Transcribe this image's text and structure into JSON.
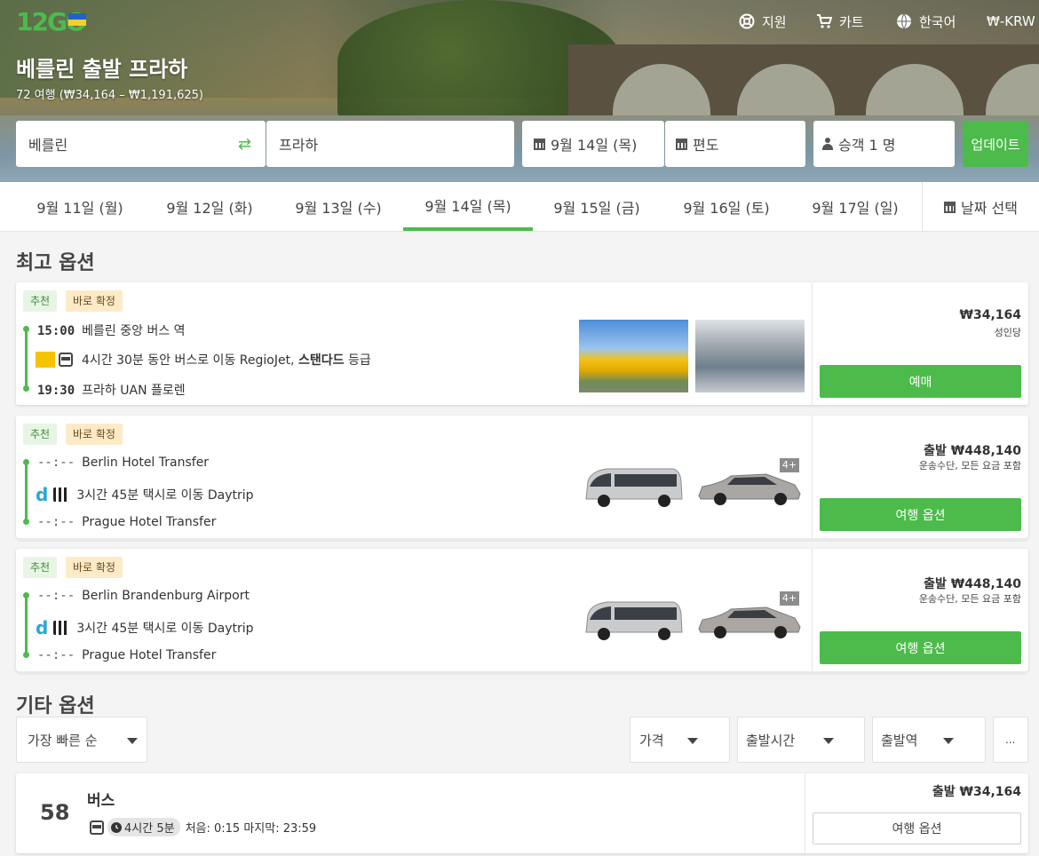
{
  "header": {
    "logo_text": "12GO",
    "nav": [
      {
        "label": "지원",
        "icon": "lifebuoy-icon"
      },
      {
        "label": "카트",
        "icon": "cart-icon"
      },
      {
        "label": "한국어",
        "icon": "globe-icon"
      },
      {
        "label": "₩-KRW",
        "icon": ""
      }
    ]
  },
  "route": {
    "title": "베를린 출발 프라하",
    "summary": "72 여행 (₩34,164 – ₩1,191,625)"
  },
  "search": {
    "from": "베를린",
    "to": "프라하",
    "date": "9월 14일 (목)",
    "return": "편도",
    "passengers": "승객 1 명",
    "update_label": "업데이트"
  },
  "date_tabs": [
    "9월 11일 (월)",
    "9월 12일 (화)",
    "9월 13일 (수)",
    "9월 14일 (목)",
    "9월 15일 (금)",
    "9월 16일 (토)",
    "9월 17일 (일)"
  ],
  "active_date_index": 3,
  "date_picker_label": "날짜 선택",
  "best_options_title": "최고 옵션",
  "badges": {
    "recommended": "추천",
    "instant": "바로 확정"
  },
  "best_options": [
    {
      "dep_time": "15:00",
      "dep_station": "베를린 중앙 버스 역",
      "trip_prefix": "4시간 30분 동안 버스로 이동 RegioJet,",
      "trip_class": "스탠다드",
      "trip_suffix": "등급",
      "arr_time": "19:30",
      "arr_station": "프라하 UAN 플로렌",
      "price": "₩34,164",
      "price_note": "성인당",
      "button": "예매",
      "more": ""
    },
    {
      "dep_time": "--:--",
      "dep_station": "Berlin Hotel Transfer",
      "trip_prefix": "3시간 45분 택시로 이동 Daytrip",
      "trip_class": "",
      "trip_suffix": "",
      "arr_time": "--:--",
      "arr_station": "Prague Hotel Transfer",
      "price": "출발 ₩448,140",
      "price_note": "운송수단, 모든 요금 포함",
      "button": "여행 옵션",
      "more": "4+"
    },
    {
      "dep_time": "--:--",
      "dep_station": "Berlin Brandenburg Airport",
      "trip_prefix": "3시간 45분 택시로 이동 Daytrip",
      "trip_class": "",
      "trip_suffix": "",
      "arr_time": "--:--",
      "arr_station": "Prague Hotel Transfer",
      "price": "출발 ₩448,140",
      "price_note": "운송수단, 모든 요금 포함",
      "button": "여행 옵션",
      "more": "4+"
    }
  ],
  "other_options_title": "기타 옵션",
  "filters": {
    "sort": "가장 빠른 순",
    "price": "가격",
    "departure_time": "출발시간",
    "departure_station": "출발역",
    "more": "..."
  },
  "other_result": {
    "count": "58",
    "mode": "버스",
    "duration": "4시간 5분",
    "schedule": "처음: 0:15 마지막: 23:59",
    "price": "출발 ₩34,164",
    "button": "여행 옵션"
  },
  "colors": {
    "accent": "#4cbb4b",
    "instant_badge": "#fdebc8",
    "recommended_badge": "#e8f5e4"
  }
}
